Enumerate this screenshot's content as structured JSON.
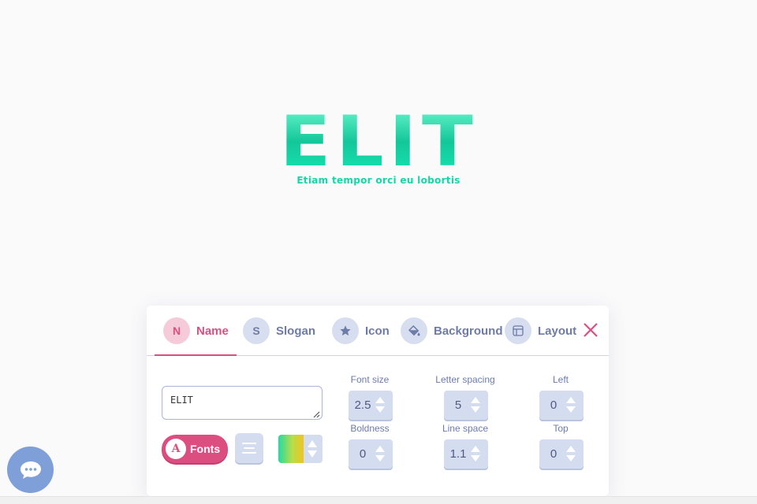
{
  "logo": {
    "name": "ELIT",
    "slogan": "Etiam tempor orci eu lobortis"
  },
  "tabs": [
    {
      "initial": "N",
      "label": "Name",
      "active": true
    },
    {
      "initial": "S",
      "label": "Slogan",
      "active": false
    },
    {
      "icon": "star-icon",
      "label": "Icon",
      "active": false
    },
    {
      "icon": "paint-bucket-icon",
      "label": "Background",
      "active": false
    },
    {
      "icon": "layout-icon",
      "label": "Layout",
      "active": false
    }
  ],
  "name_editor": {
    "text_value": "ELIT",
    "fonts_button_icon_letter": "A",
    "fonts_button_label": "Fonts",
    "align_icon": "align-center-icon",
    "color_gradient": [
      "#23dca0",
      "#f1c51c"
    ]
  },
  "controls": {
    "font_size": {
      "label": "Font size",
      "value": "2.5"
    },
    "letter_spacing": {
      "label": "Letter spacing",
      "value": "5"
    },
    "left": {
      "label": "Left",
      "value": "0"
    },
    "boldness": {
      "label": "Boldness",
      "value": "0"
    },
    "line_space": {
      "label": "Line space",
      "value": "1.1"
    },
    "top": {
      "label": "Top",
      "value": "0"
    }
  },
  "colors": {
    "accent": "#dd4e80",
    "logo": "#16d6a8",
    "muted": "#6d7ba8",
    "chip": "#d4dcef",
    "chat": "#7f9fd8"
  },
  "chat_icon": "chat-bubble-icon",
  "close_icon": "close-icon"
}
